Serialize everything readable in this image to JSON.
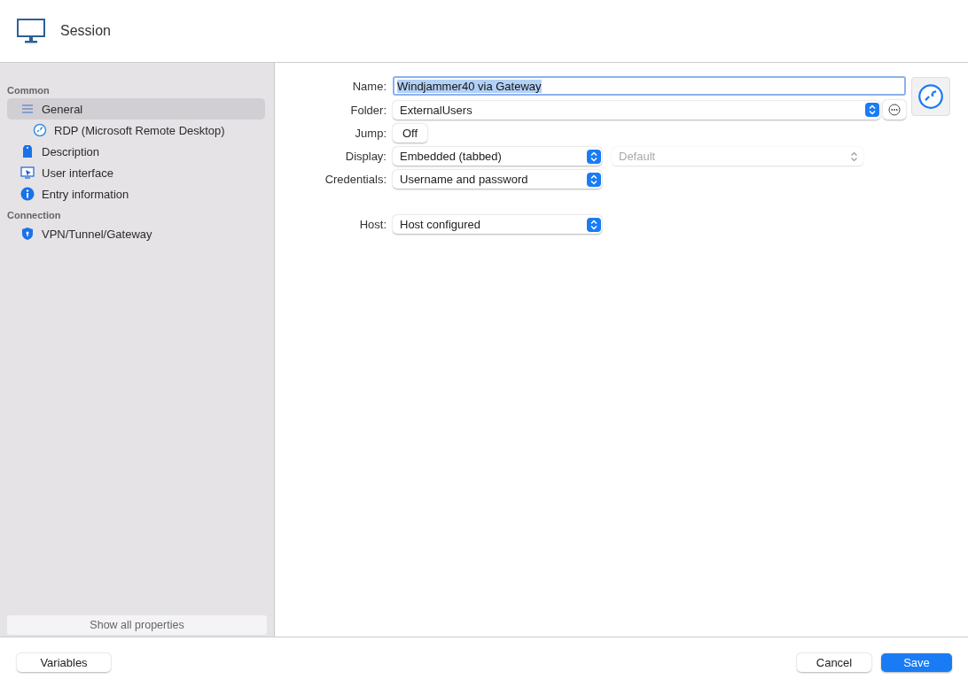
{
  "window": {
    "title": "Session"
  },
  "sidebar": {
    "groups": [
      {
        "title": "Common",
        "items": [
          {
            "label": "General",
            "kind": "lines",
            "selected": true,
            "children": [
              {
                "label": "RDP (Microsoft Remote Desktop)",
                "kind": "rdp",
                "selected": false
              }
            ]
          },
          {
            "label": "Description",
            "kind": "tag",
            "selected": false
          },
          {
            "label": "User interface",
            "kind": "screen",
            "selected": false
          },
          {
            "label": "Entry information",
            "kind": "info",
            "selected": false
          }
        ]
      },
      {
        "title": "Connection",
        "items": [
          {
            "label": "VPN/Tunnel/Gateway",
            "kind": "shield",
            "selected": false
          }
        ]
      }
    ],
    "show_all": "Show all properties"
  },
  "form": {
    "rows": [
      {
        "label": "Name:",
        "kind": "text",
        "value": "Windjammer40 via Gateway",
        "focused": true,
        "text_selected": true
      },
      {
        "label": "Folder:",
        "kind": "select",
        "value": "ExternalUsers",
        "wide": true,
        "more_button": true
      },
      {
        "label": "Jump:",
        "kind": "toggle",
        "value": "Off"
      },
      {
        "label": "Display:",
        "kind": "select",
        "value": "Embedded (tabbed)",
        "secondary": {
          "value": "Default",
          "disabled": true
        }
      },
      {
        "label": "Credentials:",
        "kind": "select",
        "value": "Username and password"
      },
      {
        "kind": "spacer"
      },
      {
        "label": "Host:",
        "kind": "select",
        "value": "Host configured"
      }
    ]
  },
  "footer": {
    "left_button": "Variables",
    "cancel": "Cancel",
    "save": "Save"
  }
}
